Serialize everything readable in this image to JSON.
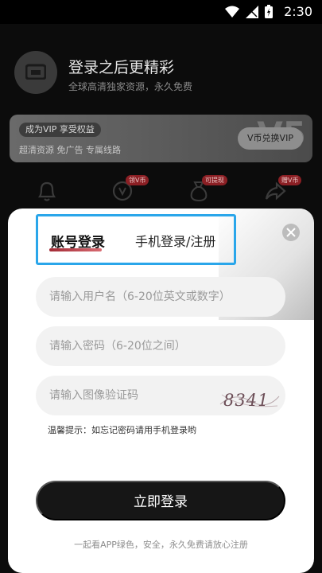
{
  "status": {
    "time": "2:30"
  },
  "profile": {
    "title": "登录之后更精彩",
    "subtitle": "全球高清独家资源，永久免费"
  },
  "vip": {
    "tag": "成为VIP 享受权益",
    "perks": "超清资源  免广告  专属线路",
    "button": "V币兑换VIP",
    "deco": "V5"
  },
  "icon_badges": [
    "领V币",
    "可提现",
    "赠V币"
  ],
  "modal": {
    "tab_account": "账号登录",
    "tab_phone": "手机登录/注册",
    "username_placeholder": "请输入用户名（6-20位英文或数字）",
    "password_placeholder": "请输入密码（6-20位之间）",
    "captcha_placeholder": "请输入图像验证码",
    "captcha_text": "8341",
    "hint": "温馨提示：如忘记密码请用手机登录哟",
    "submit": "立即登录",
    "footer": "一起看APP绿色，安全，永久免费请放心注册"
  },
  "colors": {
    "accent_highlight": "#2aa6ea",
    "tab_underline": "#a32b36",
    "badge": "#8b1f24",
    "submit_bg": "#161616"
  }
}
